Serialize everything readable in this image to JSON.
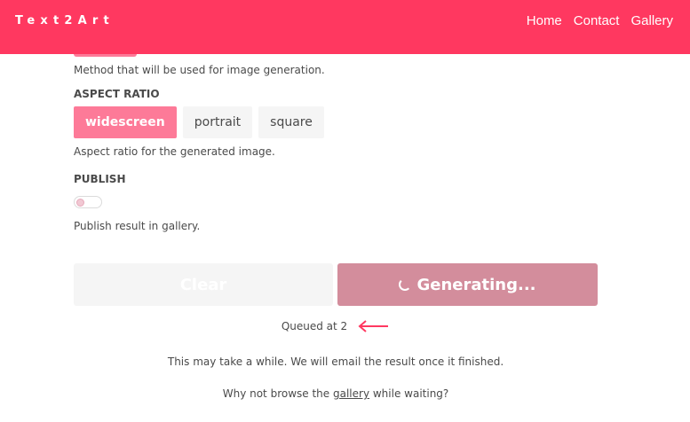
{
  "navbar": {
    "brand": "Text2Art",
    "links": [
      "Home",
      "Contact",
      "Gallery"
    ]
  },
  "method": {
    "help": "Method that will be used for image generation."
  },
  "aspect_ratio": {
    "label": "ASPECT RATIO",
    "options": [
      "widescreen",
      "portrait",
      "square"
    ],
    "selected": "widescreen",
    "help": "Aspect ratio for the generated image."
  },
  "publish": {
    "label": "PUBLISH",
    "enabled": false,
    "help": "Publish result in gallery."
  },
  "actions": {
    "clear_label": "Clear",
    "generate_label": "Generating..."
  },
  "status": {
    "queue_text": "Queued at 2",
    "wait_text": "This may take a while. We will email the result once it finished.",
    "browse_prefix": "Why not browse the ",
    "browse_link": "gallery",
    "browse_suffix": " while waiting?"
  },
  "colors": {
    "primary": "#ff3860",
    "tag_active": "#fd7a98",
    "button_loading": "#d38d9c",
    "arrow": "#ff3860"
  },
  "icons": {
    "spinner": "loading-spinner-icon",
    "arrow": "arrow-left-icon"
  }
}
